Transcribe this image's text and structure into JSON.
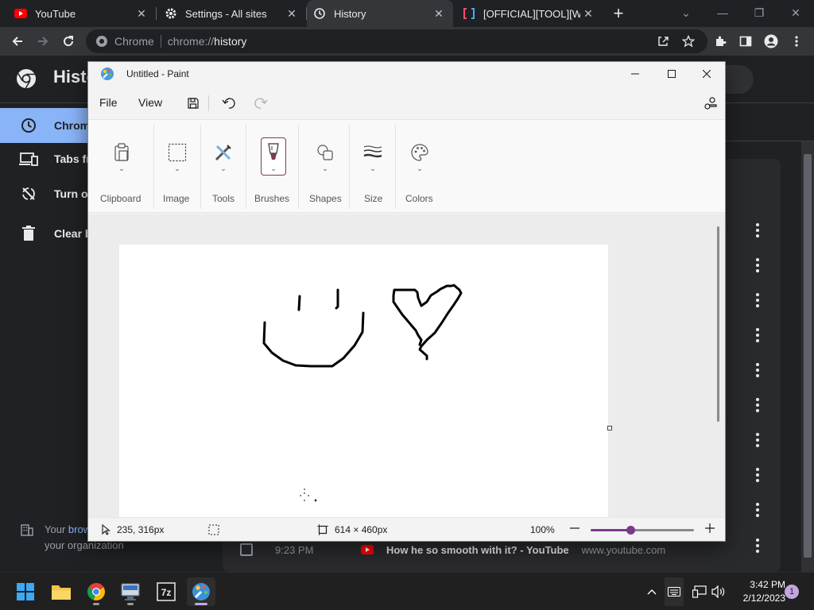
{
  "browser": {
    "tabs": [
      {
        "title": "YouTube",
        "favicon": "youtube-icon",
        "active": false
      },
      {
        "title": "Settings - All sites",
        "favicon": "gear-icon",
        "active": false
      },
      {
        "title": "History",
        "favicon": "history-icon",
        "active": true
      },
      {
        "title": "[OFFICIAL][TOOL][WIN",
        "favicon": "bracket-icon",
        "active": false
      }
    ],
    "omnibox": {
      "scheme_label": "Chrome",
      "url_prefix": "chrome://",
      "url_host": "history"
    }
  },
  "history_page": {
    "title": "History",
    "sidebar": [
      {
        "label": "Chrome history",
        "icon": "clock-icon",
        "active": true
      },
      {
        "label": "Tabs from other devices",
        "icon": "devices-icon",
        "active": false
      },
      {
        "label": "Turn off",
        "icon": "sync-off-icon",
        "active": false
      },
      {
        "label": "Clear browsing data",
        "icon": "trash-icon",
        "active": false
      }
    ],
    "managed_note": {
      "prefix": "Your ",
      "link": "browser is managed by",
      "suffix": "your organization"
    },
    "last_row": {
      "time": "9:23 PM",
      "title": "How he so smooth with it? - YouTube",
      "domain": "www.youtube.com"
    }
  },
  "paint": {
    "window_title": "Untitled - Paint",
    "menu": {
      "file": "File",
      "view": "View"
    },
    "ribbon_groups": [
      "Clipboard",
      "Image",
      "Tools",
      "Brushes",
      "Shapes",
      "Size",
      "Colors"
    ],
    "status": {
      "cursor_position": "235, 316px",
      "canvas_size": "614 × 460px",
      "zoom": "100%",
      "zoom_level": 0.38
    }
  },
  "taskbar": {
    "apps": [
      "windows-start-icon",
      "file-explorer-icon",
      "chrome-icon",
      "remote-desktop-icon",
      "7zip-icon",
      "paint-icon"
    ],
    "time": "3:42 PM",
    "date": "2/12/2023",
    "notification_count": "1"
  },
  "colors": {
    "accent_paint": "#7a3a8a",
    "chrome_active_item": "#8ab4f8",
    "youtube_red": "#ff0000"
  }
}
